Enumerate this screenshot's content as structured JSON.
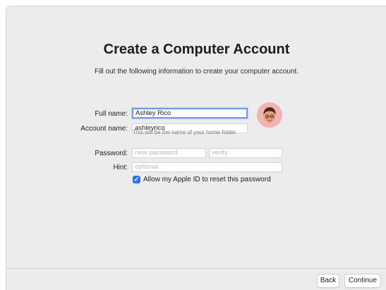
{
  "title": "Create a Computer Account",
  "subtitle": "Fill out the following information to create your computer account.",
  "form": {
    "full_name_label": "Full name:",
    "full_name_value": "Ashley Rico",
    "account_name_label": "Account name:",
    "account_name_value": "ashleyrico",
    "account_hint": "This will be the name of your home folder.",
    "password_label": "Password:",
    "password_placeholder": "new password",
    "verify_placeholder": "verify",
    "hint_label": "Hint:",
    "hint_placeholder": "optional",
    "apple_id_checkbox_label": "Allow my Apple ID to reset this password",
    "apple_id_checked": true
  },
  "avatar": {
    "icon": "memoji-avatar-icon"
  },
  "footer": {
    "back_label": "Back",
    "continue_label": "Continue"
  },
  "colors": {
    "accent": "#2f73e0",
    "focus_ring": "#6f9be6",
    "avatar_bg": "#f3b3b3",
    "window_bg": "#ececec"
  }
}
